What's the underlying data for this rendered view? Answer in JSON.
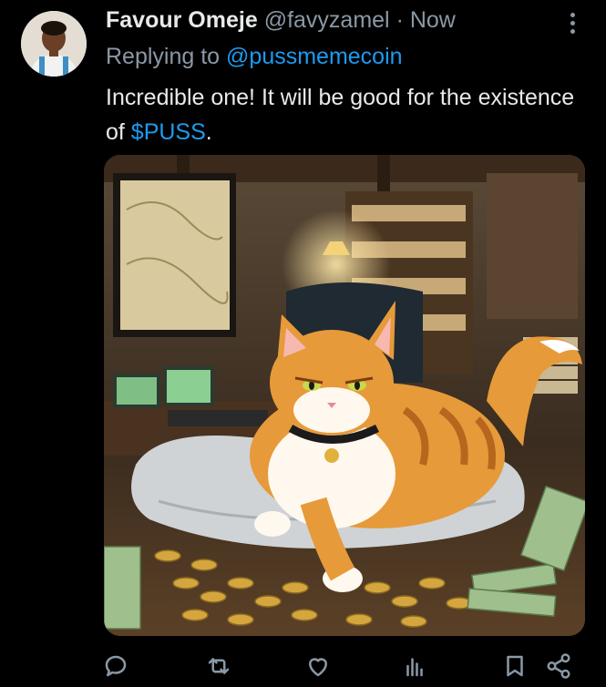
{
  "tweet": {
    "author_name": "Favour Omeje",
    "handle": "@favyzamel",
    "separator": "·",
    "time": "Now",
    "replying_to_prefix": "Replying to",
    "replying_to_handle": "@pussmemecoin",
    "text_before": "Incredible one! It will be good for the existence of ",
    "cashtag": "$PUSS",
    "text_after": "."
  },
  "media": {
    "description_icon": "cat-on-pillow-with-coins-image"
  },
  "actions": [
    {
      "icon": "reply-icon"
    },
    {
      "icon": "retweet-icon"
    },
    {
      "icon": "like-icon"
    },
    {
      "icon": "views-icon"
    },
    {
      "icon": "bookmark-icon"
    },
    {
      "icon": "share-icon"
    }
  ],
  "colors": {
    "link": "#1d9bf0",
    "muted": "#8b98a5",
    "text": "#e7e9ea",
    "background": "#000000"
  }
}
